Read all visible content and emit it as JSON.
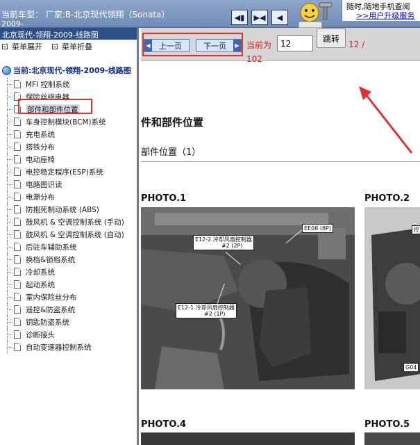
{
  "header": {
    "model_label": "当前车型：  厂家:B-北京现代领翔（Sonata）",
    "model_cont": "2009-",
    "buttons": [
      {
        "icon": "first-page-icon",
        "glyph": "◀▮"
      },
      {
        "icon": "prev-next-icon",
        "glyph": "▶◀"
      },
      {
        "icon": "prev-icon",
        "glyph": "◀"
      }
    ],
    "promo_line1": "随时,随地手机查阅",
    "promo_line2": ">>用户升级服务"
  },
  "sidebar": {
    "title": "北京现代-领翔-2009-线路图",
    "expand_label": "菜单展开",
    "collapse_label": "菜单折叠",
    "root_label": "当前:北京现代-领翔-2009-线路图",
    "items": [
      {
        "label": "MFI 控制系统"
      },
      {
        "label": "保险丝继电器"
      },
      {
        "label": "部件和部件位置",
        "selected": true
      },
      {
        "label": "车身控制模块(BCM)系统"
      },
      {
        "label": "充电系统"
      },
      {
        "label": "搭铁分布"
      },
      {
        "label": "电动座椅"
      },
      {
        "label": "电控稳定程序(ESP)系统"
      },
      {
        "label": "电路图识读"
      },
      {
        "label": "电源分布"
      },
      {
        "label": "防抱死制动系统 (ABS)"
      },
      {
        "label": "鼓风机 & 空调控制系统 (手动)"
      },
      {
        "label": "鼓风机 & 空调控制系统 (自动)"
      },
      {
        "label": "后驻车辅助系统"
      },
      {
        "label": "换档&锁档系统"
      },
      {
        "label": "冷却系统"
      },
      {
        "label": "起动系统"
      },
      {
        "label": "室内保险丝分布"
      },
      {
        "label": "遥控&防盗系统"
      },
      {
        "label": "钥匙防盗系统"
      },
      {
        "label": "诊断接头"
      },
      {
        "label": "自动变速器控制系统"
      }
    ]
  },
  "nav": {
    "prev_label": "上一页",
    "next_label": "下一页",
    "current_label": "当前为",
    "page_value": "12",
    "jump_label": "跳转",
    "total_part1": "12 /",
    "total_part2": "102"
  },
  "content": {
    "section_title": "件和部件位置",
    "sub_title": "部件位置（1）",
    "photo1_label": "PHOTO.1",
    "photo2_label": "PHOTO.2",
    "photo4_label": "PHOTO.4",
    "photo5_label": "PHOTO.5",
    "callout_e122": "E12-2  冷却风扇控制器",
    "callout_e122_sub": "#2 (2P)",
    "callout_e08": "EE08 (8P)",
    "callout_e121": "E12-1  冷却风扇控制器",
    "callout_e121_sub": "#2 (1P)",
    "callout_p2_top": "控",
    "callout_p2_bottom": "G04"
  },
  "colors": {
    "header_blue": "#7f98c1",
    "sidebar_title": "#2c4f8a",
    "highlight_red": "#e03030",
    "text_red": "#d02020"
  }
}
